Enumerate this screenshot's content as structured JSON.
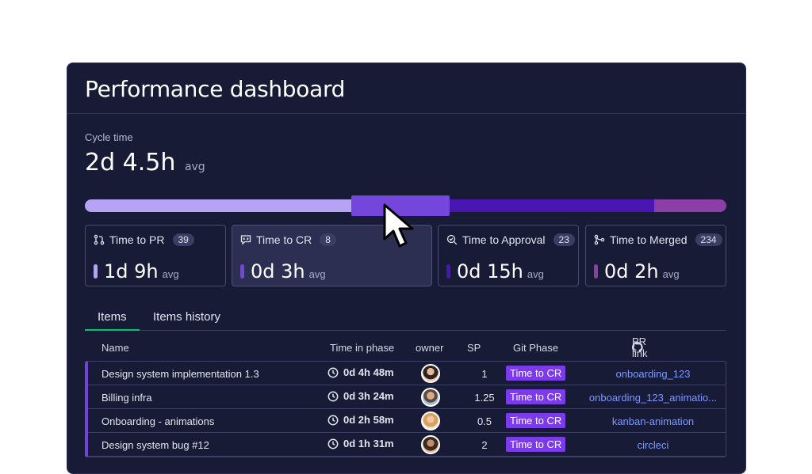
{
  "title": "Performance dashboard",
  "cycle": {
    "label": "Cycle time",
    "value": "2d 4.5h",
    "avg": "avg"
  },
  "cards": [
    {
      "label": "Time to PR",
      "count": "39",
      "value": "1d 9h",
      "avg": "avg",
      "color": "#b5a3f3"
    },
    {
      "label": "Time to CR",
      "count": "8",
      "value": "0d 3h",
      "avg": "avg",
      "color": "#7446dc"
    },
    {
      "label": "Time to Approval",
      "count": "23",
      "value": "0d 15h",
      "avg": "avg",
      "color": "#4a16b2"
    },
    {
      "label": "Time to Merged",
      "count": "234",
      "value": "0d 2h",
      "avg": "avg",
      "color": "#8a3ea6"
    }
  ],
  "tabs": [
    "Items",
    "Items history"
  ],
  "columns": {
    "name": "Name",
    "time": "Time in phase",
    "owner": "owner",
    "sp": "SP",
    "phase": "Git Phase",
    "link": "PR link"
  },
  "rows": [
    {
      "name": "Design system implementation 1.3",
      "d": "0d",
      "h": "4h",
      "m": "48m",
      "sp": "1",
      "phase": "Time to CR",
      "link": "onboarding_123"
    },
    {
      "name": "Billing infra",
      "d": "0d",
      "h": "3h",
      "m": "24m",
      "sp": "1.25",
      "phase": "Time to CR",
      "link": "onboarding_123_animatio..."
    },
    {
      "name": "Onboarding - animations",
      "d": "0d",
      "h": "2h",
      "m": "58m",
      "sp": "0.5",
      "phase": "Time to CR",
      "link": "kanban-animation"
    },
    {
      "name": "Design system bug #12",
      "d": "0d",
      "h": "1h",
      "m": "31m",
      "sp": "2",
      "phase": "Time to CR",
      "link": "circleci"
    }
  ]
}
